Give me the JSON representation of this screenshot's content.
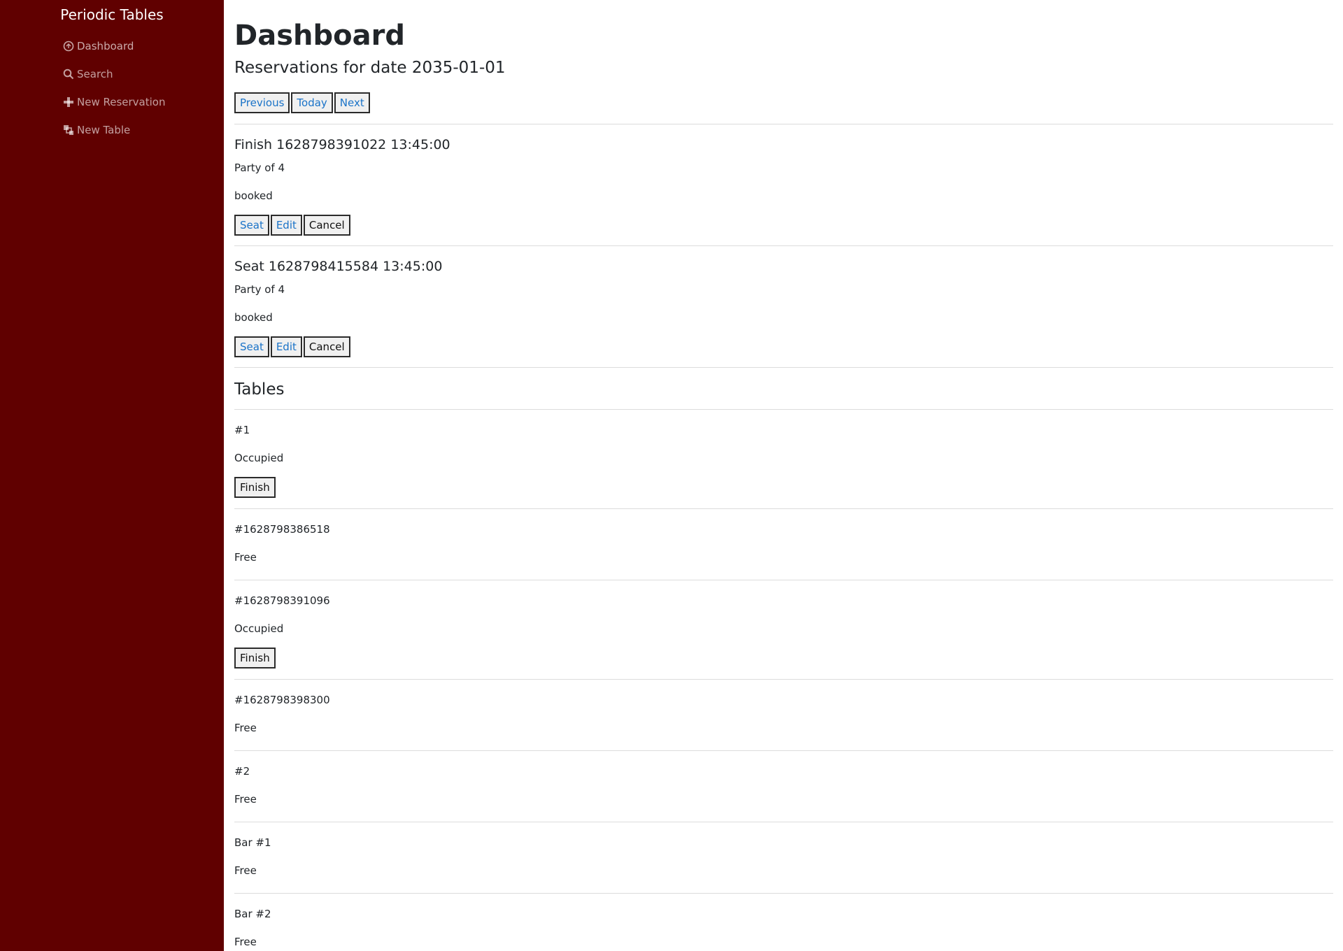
{
  "sidebar": {
    "brand": "Periodic Tables",
    "items": [
      {
        "label": "Dashboard",
        "icon": "dashboard-icon"
      },
      {
        "label": "Search",
        "icon": "search-icon"
      },
      {
        "label": "New Reservation",
        "icon": "plus-icon"
      },
      {
        "label": "New Table",
        "icon": "layers-icon"
      }
    ]
  },
  "main": {
    "title": "Dashboard",
    "date_heading": "Reservations for date 2035-01-01",
    "date_nav": {
      "previous": "Previous",
      "today": "Today",
      "next": "Next"
    },
    "reservations": [
      {
        "title": "Finish 1628798391022 13:45:00",
        "party": "Party of 4",
        "status": "booked",
        "seat": "Seat",
        "edit": "Edit",
        "cancel": "Cancel"
      },
      {
        "title": "Seat 1628798415584 13:45:00",
        "party": "Party of 4",
        "status": "booked",
        "seat": "Seat",
        "edit": "Edit",
        "cancel": "Cancel"
      }
    ],
    "tables_heading": "Tables",
    "tables": [
      {
        "name": "#1",
        "status": "Occupied",
        "finish": "Finish"
      },
      {
        "name": "#1628798386518",
        "status": "Free"
      },
      {
        "name": "#1628798391096",
        "status": "Occupied",
        "finish": "Finish"
      },
      {
        "name": "#1628798398300",
        "status": "Free"
      },
      {
        "name": "#2",
        "status": "Free"
      },
      {
        "name": "Bar #1",
        "status": "Free"
      },
      {
        "name": "Bar #2",
        "status": "Free"
      }
    ]
  },
  "colors": {
    "sidebar_bg": "#600000",
    "link_blue": "#1a73c8"
  }
}
